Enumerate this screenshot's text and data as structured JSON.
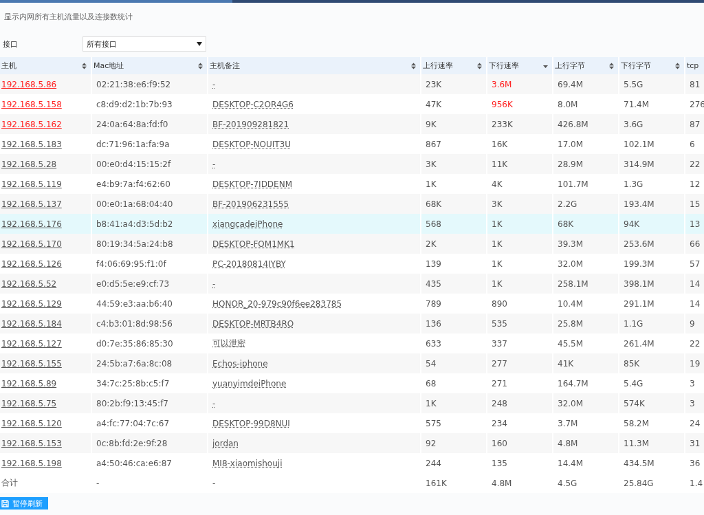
{
  "page": {
    "description": "显示内网所有主机流量以及连接数统计"
  },
  "filter": {
    "label": "接口",
    "value": "所有接口"
  },
  "table": {
    "columns": [
      {
        "label": "主机",
        "sorted": false
      },
      {
        "label": "Mac地址",
        "sorted": false
      },
      {
        "label": "主机备注",
        "sorted": false
      },
      {
        "label": "上行速率",
        "sorted": false
      },
      {
        "label": "下行速率",
        "sorted": true
      },
      {
        "label": "上行字节",
        "sorted": false
      },
      {
        "label": "下行字节",
        "sorted": false
      },
      {
        "label": "tcp"
      }
    ],
    "rows": [
      {
        "host": "192.168.5.86",
        "mac": "02:21:38:e6:f9:52",
        "note": "-",
        "up": "23K",
        "down": "3.6M",
        "up_bytes": "69.4M",
        "down_bytes": "5.5G",
        "tcp": "81",
        "host_alert": true,
        "down_alert": true,
        "selected": false
      },
      {
        "host": "192.168.5.158",
        "mac": "c8:d9:d2:1b:7b:93",
        "note": "DESKTOP-C2OR4G6",
        "up": "47K",
        "down": "956K",
        "up_bytes": "8.0M",
        "down_bytes": "71.4M",
        "tcp": "276",
        "host_alert": true,
        "down_alert": true,
        "selected": false
      },
      {
        "host": "192.168.5.162",
        "mac": "24:0a:64:8a:fd:f0",
        "note": "BF-201909281821",
        "up": "9K",
        "down": "233K",
        "up_bytes": "426.8M",
        "down_bytes": "3.6G",
        "tcp": "87",
        "host_alert": true,
        "down_alert": false,
        "selected": false
      },
      {
        "host": "192.168.5.183",
        "mac": "dc:71:96:1a:fa:9a",
        "note": "DESKTOP-NOUIT3U",
        "up": "867",
        "down": "16K",
        "up_bytes": "17.0M",
        "down_bytes": "102.1M",
        "tcp": "6",
        "host_alert": false,
        "down_alert": false,
        "selected": false
      },
      {
        "host": "192.168.5.28",
        "mac": "00:e0:d4:15:15:2f",
        "note": "-",
        "up": "3K",
        "down": "11K",
        "up_bytes": "28.9M",
        "down_bytes": "314.9M",
        "tcp": "22",
        "host_alert": false,
        "down_alert": false,
        "selected": false
      },
      {
        "host": "192.168.5.119",
        "mac": "e4:b9:7a:f4:62:60",
        "note": "DESKTOP-7IDDENM",
        "up": "1K",
        "down": "4K",
        "up_bytes": "101.7M",
        "down_bytes": "1.3G",
        "tcp": "12",
        "host_alert": false,
        "down_alert": false,
        "selected": false
      },
      {
        "host": "192.168.5.137",
        "mac": "00:e0:1a:68:04:40",
        "note": "BF-201906231555",
        "up": "68K",
        "down": "3K",
        "up_bytes": "2.2G",
        "down_bytes": "193.4M",
        "tcp": "15",
        "host_alert": false,
        "down_alert": false,
        "selected": false
      },
      {
        "host": "192.168.5.176",
        "mac": "b8:41:a4:d3:5d:b2",
        "note": "xiangcadeiPhone",
        "up": "568",
        "down": "1K",
        "up_bytes": "68K",
        "down_bytes": "94K",
        "tcp": "13",
        "host_alert": false,
        "down_alert": false,
        "selected": true
      },
      {
        "host": "192.168.5.170",
        "mac": "80:19:34:5a:24:b8",
        "note": "DESKTOP-FOM1MK1",
        "up": "2K",
        "down": "1K",
        "up_bytes": "39.3M",
        "down_bytes": "253.6M",
        "tcp": "66",
        "host_alert": false,
        "down_alert": false,
        "selected": false
      },
      {
        "host": "192.168.5.126",
        "mac": "f4:06:69:95:f1:0f",
        "note": "PC-20180814IYBY",
        "up": "139",
        "down": "1K",
        "up_bytes": "32.0M",
        "down_bytes": "199.3M",
        "tcp": "57",
        "host_alert": false,
        "down_alert": false,
        "selected": false
      },
      {
        "host": "192.168.5.52",
        "mac": "e0:d5:5e:e9:cf:73",
        "note": "-",
        "up": "435",
        "down": "1K",
        "up_bytes": "258.1M",
        "down_bytes": "398.1M",
        "tcp": "14",
        "host_alert": false,
        "down_alert": false,
        "selected": false
      },
      {
        "host": "192.168.5.129",
        "mac": "44:59:e3:aa:b6:40",
        "note": "HONOR_20-979c90f6ee283785",
        "up": "789",
        "down": "890",
        "up_bytes": "10.4M",
        "down_bytes": "291.1M",
        "tcp": "14",
        "host_alert": false,
        "down_alert": false,
        "selected": false
      },
      {
        "host": "192.168.5.184",
        "mac": "c4:b3:01:8d:98:56",
        "note": "DESKTOP-MRTB4RO",
        "up": "136",
        "down": "535",
        "up_bytes": "25.8M",
        "down_bytes": "1.1G",
        "tcp": "9",
        "host_alert": false,
        "down_alert": false,
        "selected": false
      },
      {
        "host": "192.168.5.127",
        "mac": "d0:7e:35:86:85:30",
        "note": "可以泄密",
        "up": "633",
        "down": "337",
        "up_bytes": "45.5M",
        "down_bytes": "261.4M",
        "tcp": "22",
        "host_alert": false,
        "down_alert": false,
        "selected": false
      },
      {
        "host": "192.168.5.155",
        "mac": "24:5b:a7:6a:8c:08",
        "note": "Echos-iphone",
        "up": "54",
        "down": "277",
        "up_bytes": "41K",
        "down_bytes": "85K",
        "tcp": "19",
        "host_alert": false,
        "down_alert": false,
        "selected": false
      },
      {
        "host": "192.168.5.89",
        "mac": "34:7c:25:8b:c5:f7",
        "note": "yuanyimdeiPhone",
        "up": "68",
        "down": "271",
        "up_bytes": "164.7M",
        "down_bytes": "5.4G",
        "tcp": "3",
        "host_alert": false,
        "down_alert": false,
        "selected": false
      },
      {
        "host": "192.168.5.75",
        "mac": "80:2b:f9:13:45:f7",
        "note": "-",
        "up": "1K",
        "down": "248",
        "up_bytes": "32.0M",
        "down_bytes": "574K",
        "tcp": "3",
        "host_alert": false,
        "down_alert": false,
        "selected": false
      },
      {
        "host": "192.168.5.120",
        "mac": "a4:fc:77:04:7c:67",
        "note": "DESKTOP-99D8NUI",
        "up": "575",
        "down": "234",
        "up_bytes": "3.7M",
        "down_bytes": "58.2M",
        "tcp": "24",
        "host_alert": false,
        "down_alert": false,
        "selected": false
      },
      {
        "host": "192.168.5.153",
        "mac": "0c:8b:fd:2e:9f:28",
        "note": "jordan",
        "up": "92",
        "down": "160",
        "up_bytes": "4.8M",
        "down_bytes": "11.3M",
        "tcp": "31",
        "host_alert": false,
        "down_alert": false,
        "selected": false
      },
      {
        "host": "192.168.5.198",
        "mac": "a4:50:46:ca:e6:87",
        "note": "MI8-xiaomishouji",
        "up": "244",
        "down": "135",
        "up_bytes": "14.4M",
        "down_bytes": "434.5M",
        "tcp": "36",
        "host_alert": false,
        "down_alert": false,
        "selected": false
      }
    ],
    "total": {
      "label": "合计",
      "mac": "-",
      "note": "-",
      "up": "161K",
      "down": "4.8M",
      "up_bytes": "4.5G",
      "down_bytes": "25.84G",
      "tcp": "1.4"
    }
  },
  "pause_button": {
    "label": "暂停刷新"
  }
}
